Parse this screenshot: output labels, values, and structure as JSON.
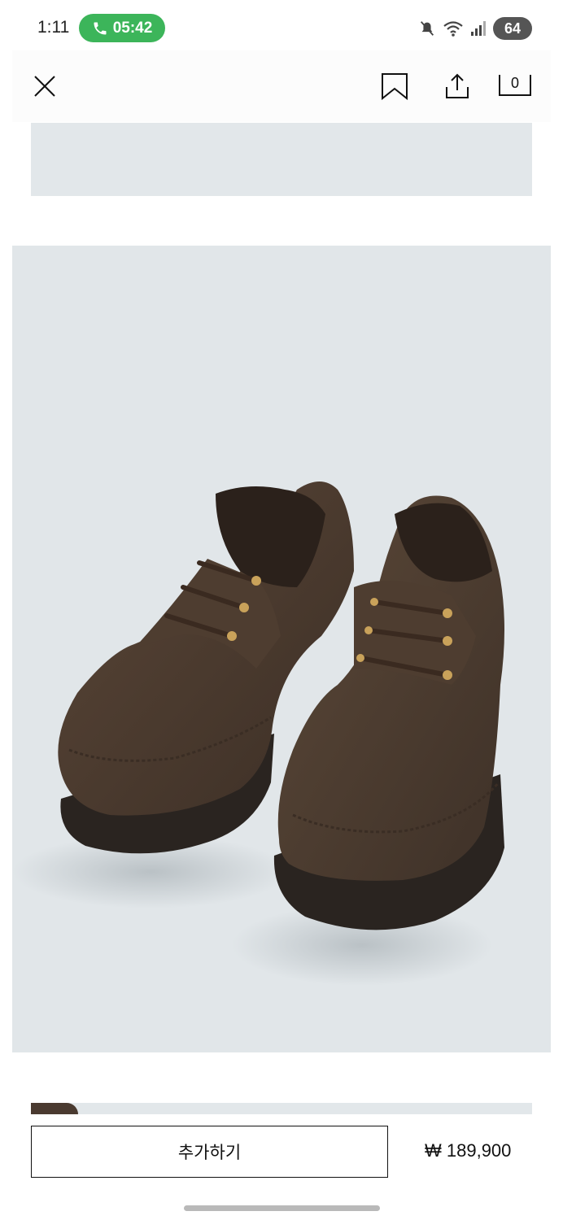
{
  "status_bar": {
    "time": "1:11",
    "call_timer": "05:42",
    "battery": "64",
    "icons": [
      "phone-icon",
      "mute-icon",
      "wifi-icon",
      "signal-icon",
      "battery-icon"
    ]
  },
  "nav": {
    "close_icon": "close-icon",
    "bookmark_icon": "bookmark-icon",
    "share_icon": "share-icon",
    "bag_count": "0"
  },
  "product": {
    "add_button_label": "추가하기",
    "price": "₩ 189,900"
  },
  "colors": {
    "call_pill": "#3cb55a",
    "image_background": "#e1e6e9",
    "shoe_suede": "#4a3a2f",
    "sole": "#2a2420"
  }
}
